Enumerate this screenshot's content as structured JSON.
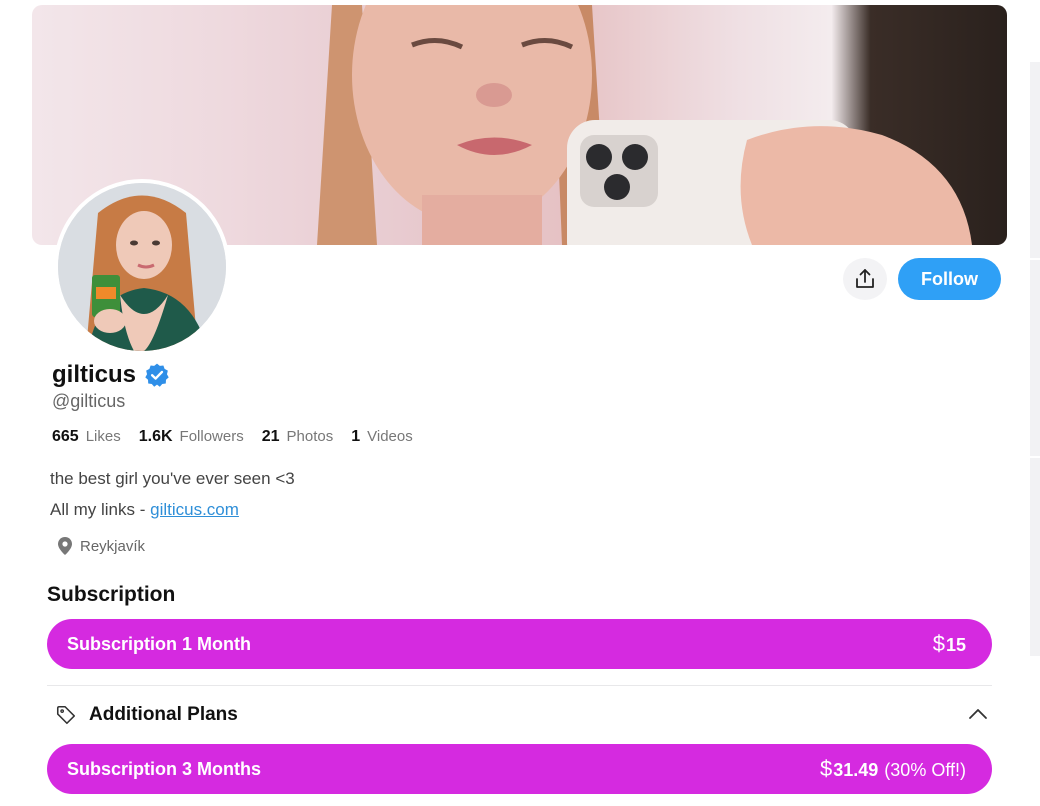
{
  "profile": {
    "name": "gilticus",
    "handle": "@gilticus",
    "verified": true,
    "stats": [
      {
        "value": "665",
        "label": "Likes"
      },
      {
        "value": "1.6K",
        "label": "Followers"
      },
      {
        "value": "21",
        "label": "Photos"
      },
      {
        "value": "1",
        "label": "Videos"
      }
    ],
    "bio": "the best girl you've ever seen <3",
    "links_prefix": "All my links - ",
    "link_text": "gilticus.com",
    "location": "Reykjavík"
  },
  "actions": {
    "share_icon": "share-upload-icon",
    "follow_label": "Follow"
  },
  "subscription": {
    "title": "Subscription",
    "plans": [
      {
        "label": "Subscription 1 Month",
        "currency": "$",
        "amount": "15",
        "discount": ""
      }
    ],
    "additional_title": "Additional Plans",
    "additional_plans": [
      {
        "label": "Subscription 3 Months",
        "currency": "$",
        "amount": "31.49",
        "discount": "(30% Off!)"
      }
    ]
  },
  "colors": {
    "accent_blue": "#2fa0f6",
    "plan_magenta": "#d52ae0",
    "link_blue": "#2f8fd8",
    "verified_blue": "#2f8fe8"
  }
}
